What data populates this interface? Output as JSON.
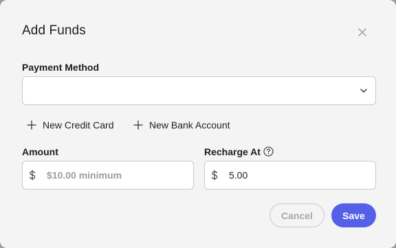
{
  "dialog": {
    "title": "Add Funds",
    "close_icon": "close-icon"
  },
  "payment_method": {
    "label": "Payment Method",
    "selected_value": "",
    "chevron_icon": "chevron-down-icon"
  },
  "actions": {
    "new_credit_card": "New Credit Card",
    "new_bank_account": "New Bank Account",
    "plus_icon": "plus-icon"
  },
  "amount": {
    "label": "Amount",
    "currency_icon": "dollar-icon",
    "value": "",
    "placeholder": "$10.00 minimum"
  },
  "recharge_at": {
    "label": "Recharge At",
    "help_icon": "help-circle-icon",
    "currency_icon": "dollar-icon",
    "value": "5.00"
  },
  "footer": {
    "cancel_label": "Cancel",
    "save_label": "Save"
  },
  "colors": {
    "primary": "#5560e8",
    "text": "#1e1e1e",
    "border": "#c9c9c9",
    "muted": "#a9a9a9"
  }
}
